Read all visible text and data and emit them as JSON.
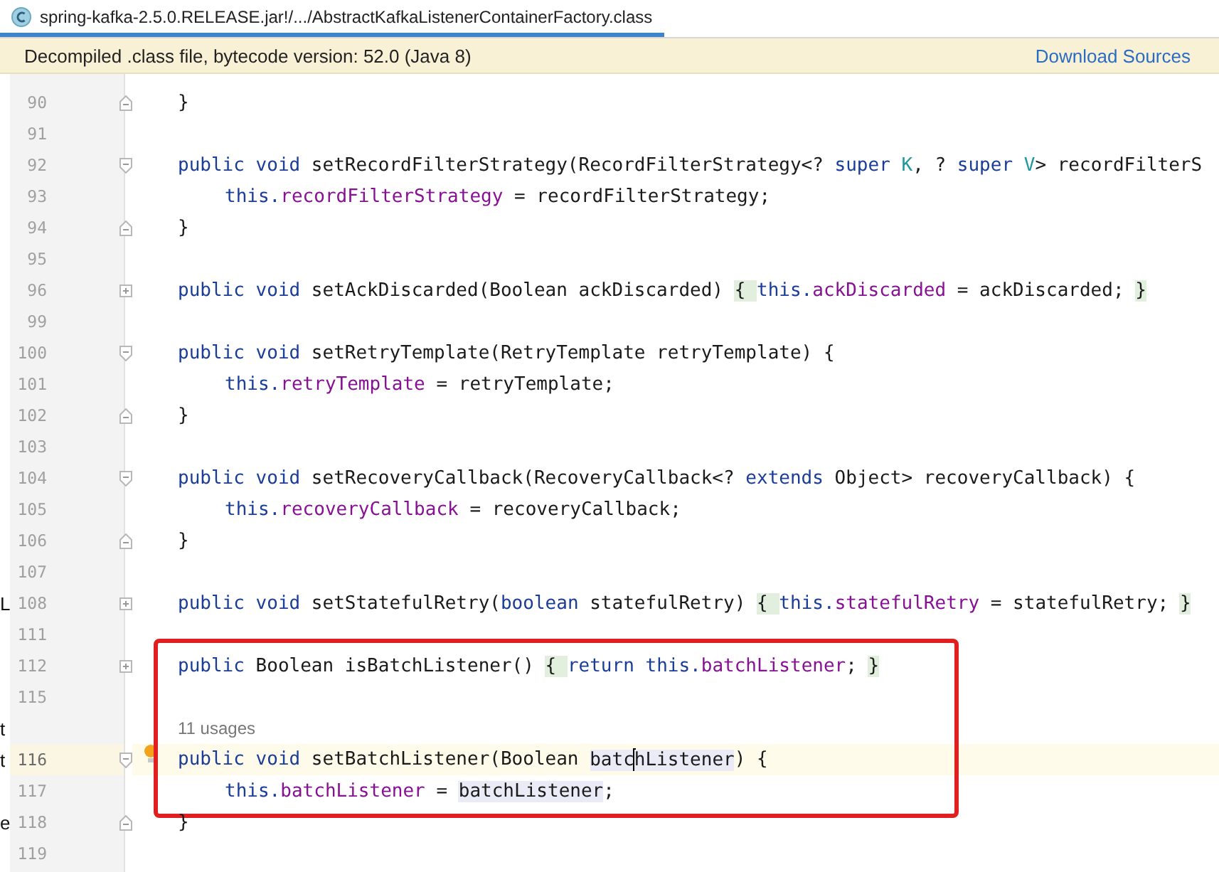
{
  "editor_tab": {
    "title": "spring-kafka-2.5.0.RELEASE.jar!/.../AbstractKafkaListenerContainerFactory.class",
    "selected": true
  },
  "banner": {
    "message": "Decompiled .class file, bytecode version: 52.0 (Java 8)",
    "link": "Download Sources"
  },
  "lines": [
    {
      "kind": "code",
      "number": "90",
      "current": false,
      "fold": {
        "kind": "close"
      },
      "tokens": [
        {
          "kind": "plain",
          "text": "}"
        }
      ]
    },
    {
      "kind": "blank",
      "number": "91",
      "current": false
    },
    {
      "kind": "code",
      "number": "92",
      "current": false,
      "fold": {
        "kind": "open"
      },
      "tokens": [
        {
          "kind": "kw",
          "text": "public void"
        },
        {
          "kind": "plain",
          "text": " setRecordFilterStrategy(RecordFilterStrategy<? "
        },
        {
          "kind": "kw",
          "text": "super "
        },
        {
          "kind": "tparam",
          "text": "K"
        },
        {
          "kind": "plain",
          "text": ", ? "
        },
        {
          "kind": "kw",
          "text": "super "
        },
        {
          "kind": "tparam",
          "text": "V"
        },
        {
          "kind": "plain",
          "text": "> recordFilterS"
        }
      ]
    },
    {
      "kind": "body",
      "number": "93",
      "current": false,
      "tokens": [
        {
          "kind": "kw",
          "text": "this."
        },
        {
          "kind": "field",
          "text": "recordFilterStrategy"
        },
        {
          "kind": "plain",
          "text": " = recordFilterStrategy;"
        }
      ]
    },
    {
      "kind": "code",
      "number": "94",
      "current": false,
      "fold": {
        "kind": "close"
      },
      "tokens": [
        {
          "kind": "plain",
          "text": "}"
        }
      ]
    },
    {
      "kind": "blank",
      "number": "95",
      "current": false
    },
    {
      "kind": "code",
      "number": "96",
      "current": false,
      "fold": {
        "kind": "collapsed"
      },
      "tokens": [
        {
          "kind": "kw",
          "text": "public void"
        },
        {
          "kind": "plain",
          "text": " setAckDiscarded(Boolean ackDiscarded) "
        },
        {
          "kind": "match",
          "text": "{ "
        },
        {
          "kind": "kw",
          "text": "this."
        },
        {
          "kind": "field",
          "text": "ackDiscarded"
        },
        {
          "kind": "plain",
          "text": " = ackDiscarded; "
        },
        {
          "kind": "match",
          "text": "}"
        }
      ]
    },
    {
      "kind": "blank",
      "number": "99",
      "current": false
    },
    {
      "kind": "code",
      "number": "100",
      "current": false,
      "fold": {
        "kind": "open"
      },
      "tokens": [
        {
          "kind": "kw",
          "text": "public void"
        },
        {
          "kind": "plain",
          "text": " setRetryTemplate(RetryTemplate retryTemplate) {"
        }
      ]
    },
    {
      "kind": "body",
      "number": "101",
      "current": false,
      "tokens": [
        {
          "kind": "kw",
          "text": "this."
        },
        {
          "kind": "field",
          "text": "retryTemplate"
        },
        {
          "kind": "plain",
          "text": " = retryTemplate;"
        }
      ]
    },
    {
      "kind": "code",
      "number": "102",
      "current": false,
      "fold": {
        "kind": "close"
      },
      "tokens": [
        {
          "kind": "plain",
          "text": "}"
        }
      ]
    },
    {
      "kind": "blank",
      "number": "103",
      "current": false
    },
    {
      "kind": "code",
      "number": "104",
      "current": false,
      "fold": {
        "kind": "open"
      },
      "tokens": [
        {
          "kind": "kw",
          "text": "public void"
        },
        {
          "kind": "plain",
          "text": " setRecoveryCallback(RecoveryCallback<? "
        },
        {
          "kind": "kw",
          "text": "extends"
        },
        {
          "kind": "plain",
          "text": " Object> recoveryCallback) {"
        }
      ]
    },
    {
      "kind": "body",
      "number": "105",
      "current": false,
      "tokens": [
        {
          "kind": "kw",
          "text": "this."
        },
        {
          "kind": "field",
          "text": "recoveryCallback"
        },
        {
          "kind": "plain",
          "text": " = recoveryCallback;"
        }
      ]
    },
    {
      "kind": "code",
      "number": "106",
      "current": false,
      "fold": {
        "kind": "close"
      },
      "tokens": [
        {
          "kind": "plain",
          "text": "}"
        }
      ]
    },
    {
      "kind": "blank",
      "number": "107",
      "current": false
    },
    {
      "kind": "code",
      "number": "108",
      "current": false,
      "side": "L",
      "fold": {
        "kind": "collapsed"
      },
      "tokens": [
        {
          "kind": "kw",
          "text": "public void"
        },
        {
          "kind": "plain",
          "text": " setStatefulRetry("
        },
        {
          "kind": "kw",
          "text": "boolean"
        },
        {
          "kind": "plain",
          "text": " statefulRetry) "
        },
        {
          "kind": "match",
          "text": "{ "
        },
        {
          "kind": "kw",
          "text": "this."
        },
        {
          "kind": "field",
          "text": "statefulRetry"
        },
        {
          "kind": "plain",
          "text": " = statefulRetry; "
        },
        {
          "kind": "match",
          "text": "}"
        }
      ]
    },
    {
      "kind": "blank",
      "number": "111",
      "current": false
    },
    {
      "kind": "group",
      "children": [
        {
          "kind": "code",
          "number": "112",
          "current": false,
          "fold": {
            "kind": "collapsed"
          },
          "tokens": [
            {
              "kind": "kw",
              "text": "public"
            },
            {
              "kind": "plain",
              "text": " Boolean isBatchListener() "
            },
            {
              "kind": "match",
              "text": "{ "
            },
            {
              "kind": "kw",
              "text": "return this."
            },
            {
              "kind": "field",
              "text": "batchListener"
            },
            {
              "kind": "plain",
              "text": "; "
            },
            {
              "kind": "match",
              "text": "}"
            }
          ]
        },
        {
          "kind": "blank",
          "number": "115",
          "current": false
        },
        {
          "kind": "hint",
          "text": "11 usages",
          "side": "t"
        },
        {
          "kind": "code",
          "number": "116",
          "current": true,
          "side": "t",
          "fold": {
            "kind": "open"
          },
          "tokens": [
            {
              "kind": "kw",
              "text": "public void"
            },
            {
              "kind": "plain",
              "text": " setBatchListener(Boolean "
            },
            {
              "kind": "ref",
              "text": "batc"
            },
            {
              "kind": "caret"
            },
            {
              "kind": "ref",
              "text": "hListener"
            },
            {
              "kind": "plain",
              "text": ") {"
            }
          ]
        },
        {
          "kind": "body",
          "number": "117",
          "current": false,
          "tokens": [
            {
              "kind": "kw",
              "text": "this."
            },
            {
              "kind": "field",
              "text": "batchListener"
            },
            {
              "kind": "plain",
              "text": " = "
            },
            {
              "kind": "ref",
              "text": "batchListener"
            },
            {
              "kind": "plain",
              "text": ";"
            }
          ]
        }
      ]
    },
    {
      "kind": "code",
      "number": "118",
      "current": false,
      "side": "e",
      "fold": {
        "kind": "close"
      },
      "tokens": [
        {
          "kind": "plain",
          "text": "}"
        }
      ]
    },
    {
      "kind": "blank",
      "number": "119",
      "current": false
    }
  ]
}
